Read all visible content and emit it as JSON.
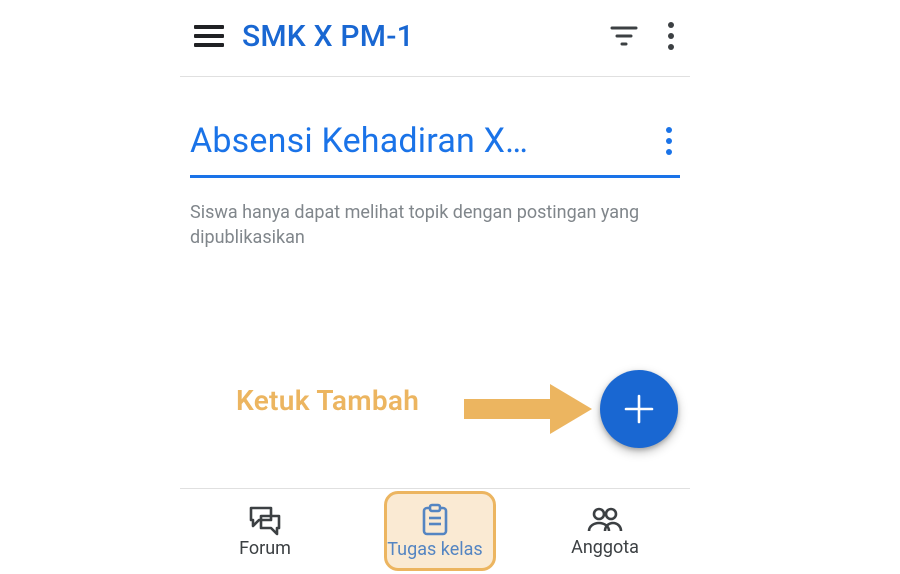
{
  "colors": {
    "primary": "#1a73e8",
    "annot": "#ecb560",
    "grey": "#3c4043"
  },
  "appbar": {
    "title": "SMK X PM-1"
  },
  "topic": {
    "title": "Absensi Kehadiran X…",
    "note": "Siswa hanya dapat melihat topik dengan postingan yang dipublikasikan"
  },
  "annotation": {
    "label": "Ketuk Tambah"
  },
  "nav": {
    "forum": "Forum",
    "classwork": "Tugas kelas",
    "people": "Anggota"
  }
}
